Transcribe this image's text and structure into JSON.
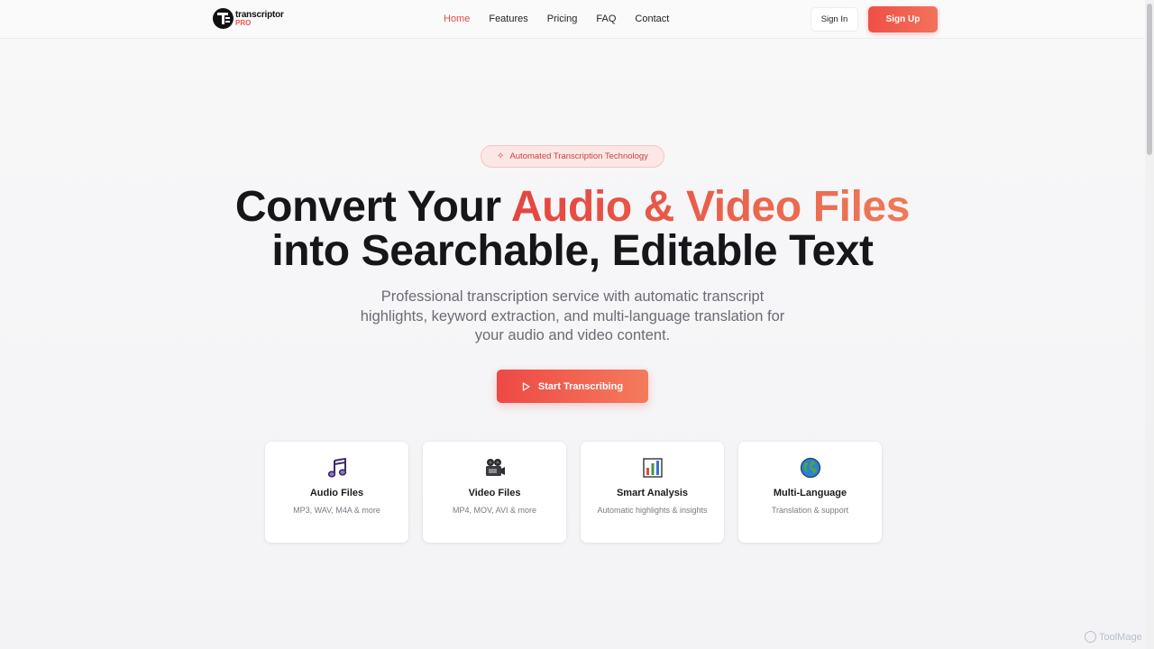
{
  "brand": {
    "name": "transcriptor",
    "suffix": "PRO"
  },
  "nav": {
    "links": [
      "Home",
      "Features",
      "Pricing",
      "FAQ",
      "Contact"
    ],
    "active": "Home",
    "sign_in": "Sign In",
    "sign_up": "Sign Up"
  },
  "hero": {
    "badge": "Automated Transcription Technology",
    "title_part1": "Convert Your ",
    "title_accent": "Audio & Video Files",
    "title_part2": "into Searchable, Editable Text",
    "subtitle": "Professional transcription service with automatic transcript highlights, keyword extraction, and multi-language translation for your audio and video content.",
    "cta": "Start Transcribing"
  },
  "features": [
    {
      "icon": "music-note-icon",
      "title": "Audio Files",
      "desc": "MP3, WAV, M4A & more"
    },
    {
      "icon": "video-camera-icon",
      "title": "Video Files",
      "desc": "MP4, MOV, AVI & more"
    },
    {
      "icon": "bar-chart-icon",
      "title": "Smart Analysis",
      "desc": "Automatic highlights & insights"
    },
    {
      "icon": "globe-icon",
      "title": "Multi-Language",
      "desc": "Translation & support"
    }
  ],
  "watermark": "ToolMage",
  "colors": {
    "accent": "#ef4f46",
    "accent_end": "#f2735a",
    "badge_bg": "#fbe7e6"
  }
}
